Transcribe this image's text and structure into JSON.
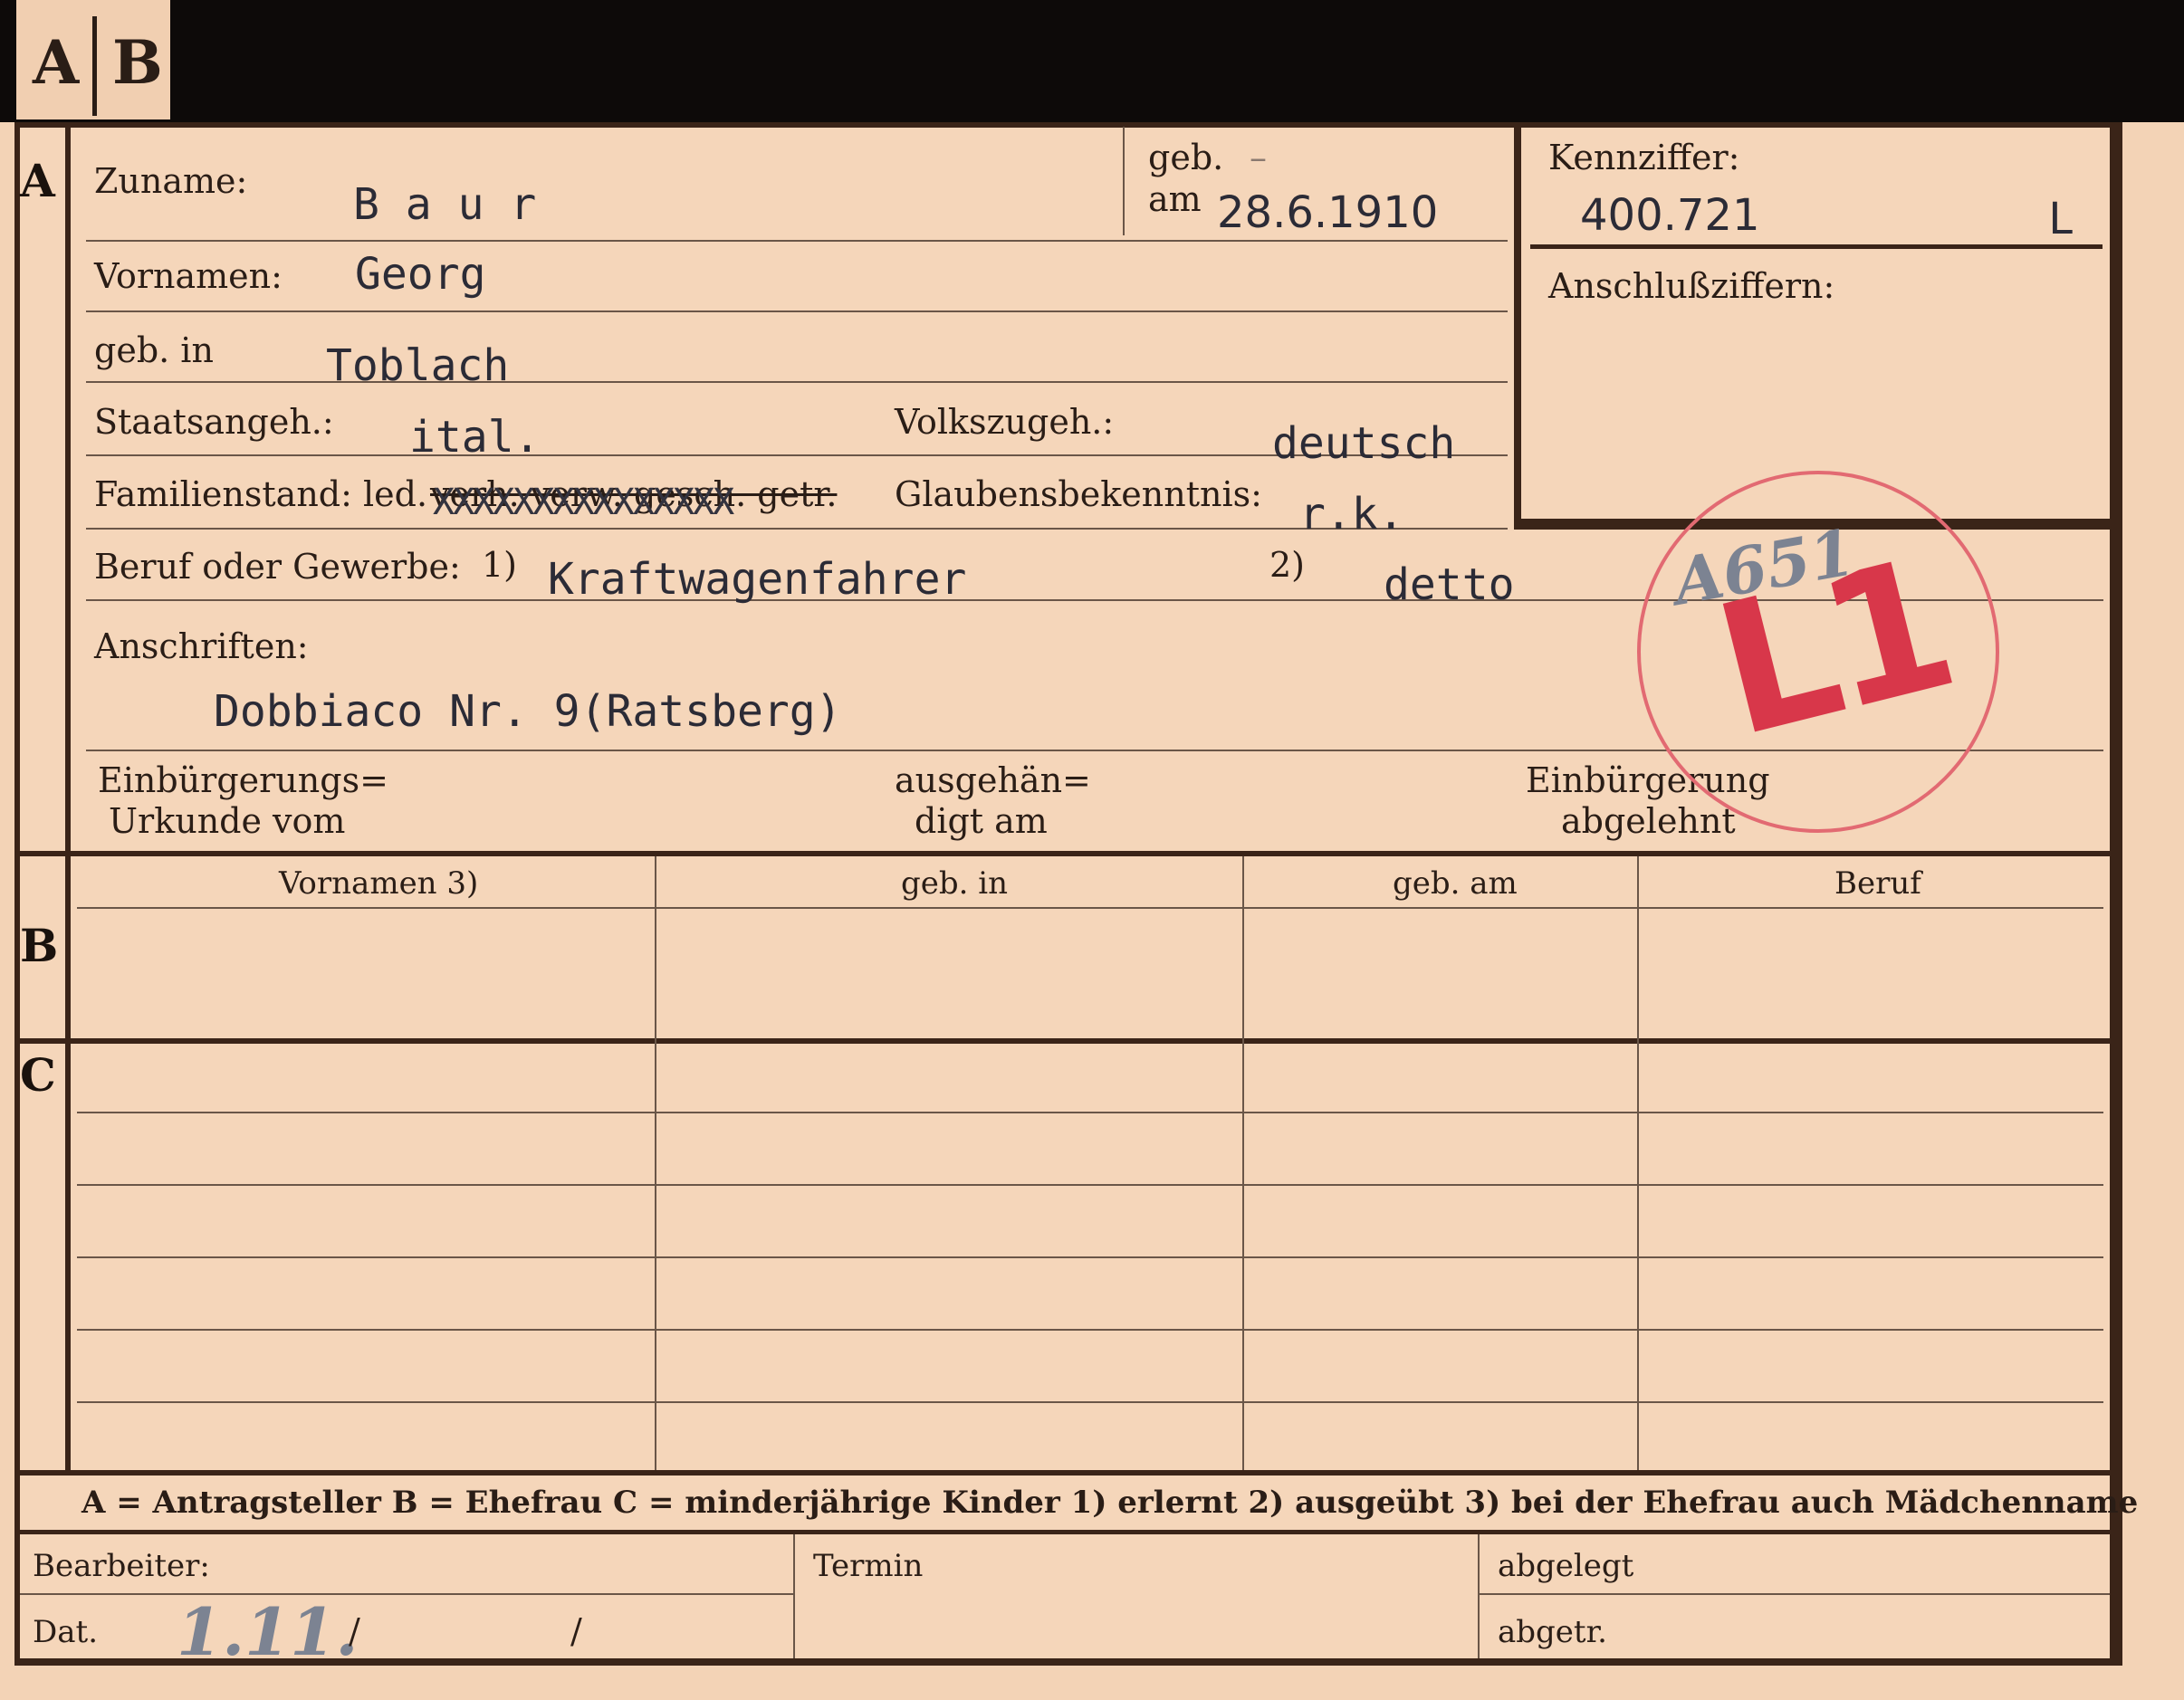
{
  "tab": {
    "a": "A",
    "b": "B"
  },
  "sections": {
    "a": "A",
    "b": "B",
    "c": "C"
  },
  "labels": {
    "zuname": "Zuname:",
    "geb": "geb.",
    "am": "am",
    "kennziffer": "Kennziffer:",
    "vornamen": "Vornamen:",
    "anschluss": "Anschlußziffern:",
    "geb_in": "geb. in",
    "staats": "Staatsangeh.:",
    "volks": "Volkszugeh.:",
    "familien": "Familienstand: led.",
    "familien_struck": "verh. verw. gesch. getr.",
    "glaubens": "Glaubensbekenntnis:",
    "beruf": "Beruf oder Gewerbe:",
    "fn1": "1)",
    "fn2": "2)",
    "anschriften": "Anschriften:",
    "einb_urk_1": "Einbürgerungs=",
    "einb_urk_2": "Urkunde vom",
    "ausgeh_1": "ausgehän=",
    "ausgeh_2": "digt am",
    "einb_abg_1": "Einbürgerung",
    "einb_abg_2": "abgelehnt"
  },
  "values": {
    "zuname": "B a u r",
    "geb_dash": "–",
    "geb_am": "28.6.1910",
    "kennziffer": "400.721",
    "kennziffer_suffix": "L",
    "vornamen": "Georg",
    "geb_in": "Toblach",
    "staats": "ital.",
    "volks": "deutsch",
    "familien_x": "XXXXXXXXXXXXXXX",
    "glaubens": "r.k.",
    "beruf1": "Kraftwagenfahrer",
    "beruf2": "detto",
    "anschrift": "Dobbiaco Nr. 9(Ratsberg)"
  },
  "table": {
    "headers": [
      "Vornamen 3)",
      "geb. in",
      "geb. am",
      "Beruf"
    ]
  },
  "legend": "A = Antragsteller   B = Ehefrau   C = minderjährige Kinder   1) erlernt   2) ausgeübt   3) bei der Ehefrau auch Mädchenname",
  "footer": {
    "bearbeiter": "Bearbeiter:",
    "dat": "Dat.",
    "slash": "/",
    "termin": "Termin",
    "abgelegt": "abgelegt",
    "abgetr": "abgetr.",
    "hand_date": "1.11."
  },
  "stamp": {
    "letters": "L1",
    "handnote": "A651"
  },
  "colors": {
    "paper": "#f5d6ba",
    "ink": "#2a1d16",
    "stamp": "#d8374a",
    "band": "#0d0a09"
  }
}
